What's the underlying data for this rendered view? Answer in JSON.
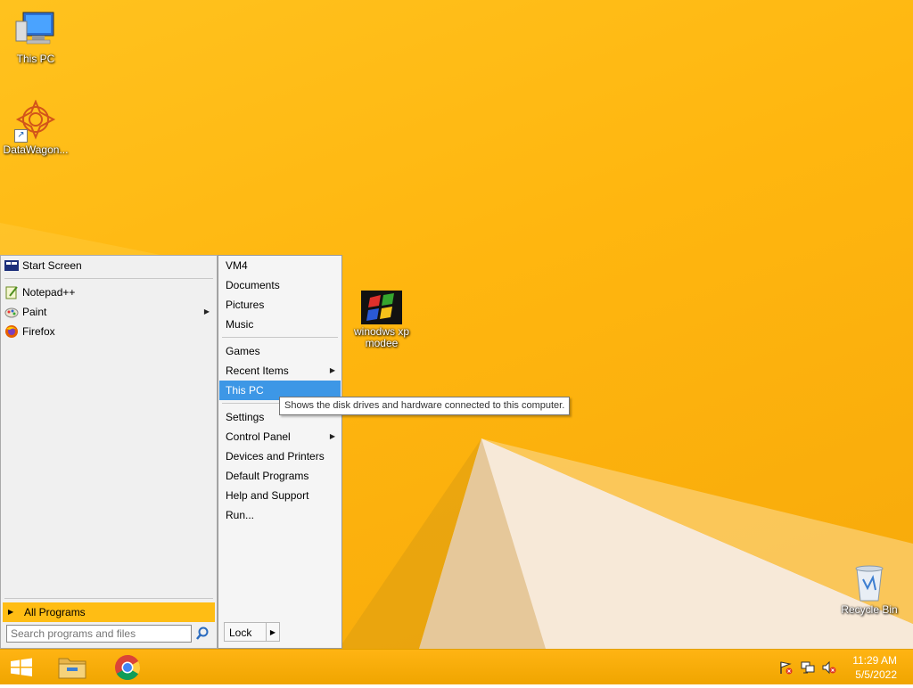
{
  "desktop": {
    "icons": [
      {
        "label": "This PC",
        "icon": "computer-icon"
      },
      {
        "label": "DataWagon...",
        "icon": "datawagon-icon"
      },
      {
        "label": "winodws xp modee",
        "icon": "windows-xp-icon"
      },
      {
        "label": "Recycle Bin",
        "icon": "recycle-bin-icon"
      }
    ]
  },
  "start_menu": {
    "pinned": [
      {
        "label": "Start Screen",
        "icon": "start-screen-icon"
      },
      {
        "label": "Notepad++",
        "icon": "notepadpp-icon"
      },
      {
        "label": "Paint",
        "icon": "paint-icon",
        "has_submenu": true
      },
      {
        "label": "Firefox",
        "icon": "firefox-icon"
      }
    ],
    "all_programs": "All Programs",
    "search_placeholder": "Search programs and files",
    "right": [
      {
        "label": "VM4"
      },
      {
        "label": "Documents"
      },
      {
        "label": "Pictures"
      },
      {
        "label": "Music"
      },
      {
        "label": "Games"
      },
      {
        "label": "Recent Items",
        "has_submenu": true
      },
      {
        "label": "This PC",
        "highlighted": true
      },
      {
        "label": "Settings"
      },
      {
        "label": "Control Panel",
        "has_submenu": true
      },
      {
        "label": "Devices and Printers"
      },
      {
        "label": "Default Programs"
      },
      {
        "label": "Help and Support"
      },
      {
        "label": "Run..."
      }
    ],
    "lock_label": "Lock"
  },
  "tooltip": "Shows the disk drives and hardware connected to this computer.",
  "taskbar": {
    "pinned": [
      {
        "icon": "windows-start-icon"
      },
      {
        "icon": "file-explorer-icon"
      },
      {
        "icon": "chrome-icon"
      }
    ],
    "tray": [
      "action-center-flag-icon",
      "network-icon",
      "volume-muted-icon"
    ],
    "time": "11:29 AM",
    "date": "5/5/2022"
  },
  "colors": {
    "accent_orange": "#ffb60f",
    "menu_highlight": "#3d97e6",
    "all_programs_bg": "#ffbd14"
  }
}
